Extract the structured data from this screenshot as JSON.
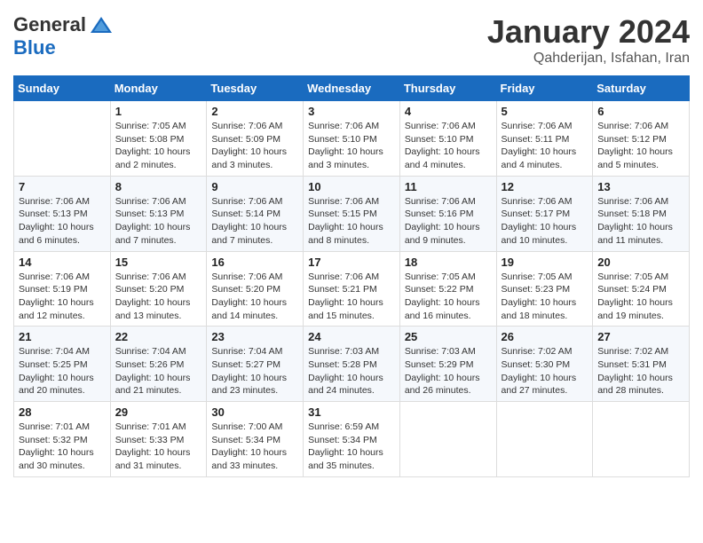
{
  "header": {
    "logo_general": "General",
    "logo_blue": "Blue",
    "month_title": "January 2024",
    "location": "Qahderijan, Isfahan, Iran"
  },
  "days_of_week": [
    "Sunday",
    "Monday",
    "Tuesday",
    "Wednesday",
    "Thursday",
    "Friday",
    "Saturday"
  ],
  "weeks": [
    [
      {
        "day": "",
        "info": ""
      },
      {
        "day": "1",
        "info": "Sunrise: 7:05 AM\nSunset: 5:08 PM\nDaylight: 10 hours\nand 2 minutes."
      },
      {
        "day": "2",
        "info": "Sunrise: 7:06 AM\nSunset: 5:09 PM\nDaylight: 10 hours\nand 3 minutes."
      },
      {
        "day": "3",
        "info": "Sunrise: 7:06 AM\nSunset: 5:10 PM\nDaylight: 10 hours\nand 3 minutes."
      },
      {
        "day": "4",
        "info": "Sunrise: 7:06 AM\nSunset: 5:10 PM\nDaylight: 10 hours\nand 4 minutes."
      },
      {
        "day": "5",
        "info": "Sunrise: 7:06 AM\nSunset: 5:11 PM\nDaylight: 10 hours\nand 4 minutes."
      },
      {
        "day": "6",
        "info": "Sunrise: 7:06 AM\nSunset: 5:12 PM\nDaylight: 10 hours\nand 5 minutes."
      }
    ],
    [
      {
        "day": "7",
        "info": "Sunrise: 7:06 AM\nSunset: 5:13 PM\nDaylight: 10 hours\nand 6 minutes."
      },
      {
        "day": "8",
        "info": "Sunrise: 7:06 AM\nSunset: 5:13 PM\nDaylight: 10 hours\nand 7 minutes."
      },
      {
        "day": "9",
        "info": "Sunrise: 7:06 AM\nSunset: 5:14 PM\nDaylight: 10 hours\nand 7 minutes."
      },
      {
        "day": "10",
        "info": "Sunrise: 7:06 AM\nSunset: 5:15 PM\nDaylight: 10 hours\nand 8 minutes."
      },
      {
        "day": "11",
        "info": "Sunrise: 7:06 AM\nSunset: 5:16 PM\nDaylight: 10 hours\nand 9 minutes."
      },
      {
        "day": "12",
        "info": "Sunrise: 7:06 AM\nSunset: 5:17 PM\nDaylight: 10 hours\nand 10 minutes."
      },
      {
        "day": "13",
        "info": "Sunrise: 7:06 AM\nSunset: 5:18 PM\nDaylight: 10 hours\nand 11 minutes."
      }
    ],
    [
      {
        "day": "14",
        "info": "Sunrise: 7:06 AM\nSunset: 5:19 PM\nDaylight: 10 hours\nand 12 minutes."
      },
      {
        "day": "15",
        "info": "Sunrise: 7:06 AM\nSunset: 5:20 PM\nDaylight: 10 hours\nand 13 minutes."
      },
      {
        "day": "16",
        "info": "Sunrise: 7:06 AM\nSunset: 5:20 PM\nDaylight: 10 hours\nand 14 minutes."
      },
      {
        "day": "17",
        "info": "Sunrise: 7:06 AM\nSunset: 5:21 PM\nDaylight: 10 hours\nand 15 minutes."
      },
      {
        "day": "18",
        "info": "Sunrise: 7:05 AM\nSunset: 5:22 PM\nDaylight: 10 hours\nand 16 minutes."
      },
      {
        "day": "19",
        "info": "Sunrise: 7:05 AM\nSunset: 5:23 PM\nDaylight: 10 hours\nand 18 minutes."
      },
      {
        "day": "20",
        "info": "Sunrise: 7:05 AM\nSunset: 5:24 PM\nDaylight: 10 hours\nand 19 minutes."
      }
    ],
    [
      {
        "day": "21",
        "info": "Sunrise: 7:04 AM\nSunset: 5:25 PM\nDaylight: 10 hours\nand 20 minutes."
      },
      {
        "day": "22",
        "info": "Sunrise: 7:04 AM\nSunset: 5:26 PM\nDaylight: 10 hours\nand 21 minutes."
      },
      {
        "day": "23",
        "info": "Sunrise: 7:04 AM\nSunset: 5:27 PM\nDaylight: 10 hours\nand 23 minutes."
      },
      {
        "day": "24",
        "info": "Sunrise: 7:03 AM\nSunset: 5:28 PM\nDaylight: 10 hours\nand 24 minutes."
      },
      {
        "day": "25",
        "info": "Sunrise: 7:03 AM\nSunset: 5:29 PM\nDaylight: 10 hours\nand 26 minutes."
      },
      {
        "day": "26",
        "info": "Sunrise: 7:02 AM\nSunset: 5:30 PM\nDaylight: 10 hours\nand 27 minutes."
      },
      {
        "day": "27",
        "info": "Sunrise: 7:02 AM\nSunset: 5:31 PM\nDaylight: 10 hours\nand 28 minutes."
      }
    ],
    [
      {
        "day": "28",
        "info": "Sunrise: 7:01 AM\nSunset: 5:32 PM\nDaylight: 10 hours\nand 30 minutes."
      },
      {
        "day": "29",
        "info": "Sunrise: 7:01 AM\nSunset: 5:33 PM\nDaylight: 10 hours\nand 31 minutes."
      },
      {
        "day": "30",
        "info": "Sunrise: 7:00 AM\nSunset: 5:34 PM\nDaylight: 10 hours\nand 33 minutes."
      },
      {
        "day": "31",
        "info": "Sunrise: 6:59 AM\nSunset: 5:34 PM\nDaylight: 10 hours\nand 35 minutes."
      },
      {
        "day": "",
        "info": ""
      },
      {
        "day": "",
        "info": ""
      },
      {
        "day": "",
        "info": ""
      }
    ]
  ]
}
